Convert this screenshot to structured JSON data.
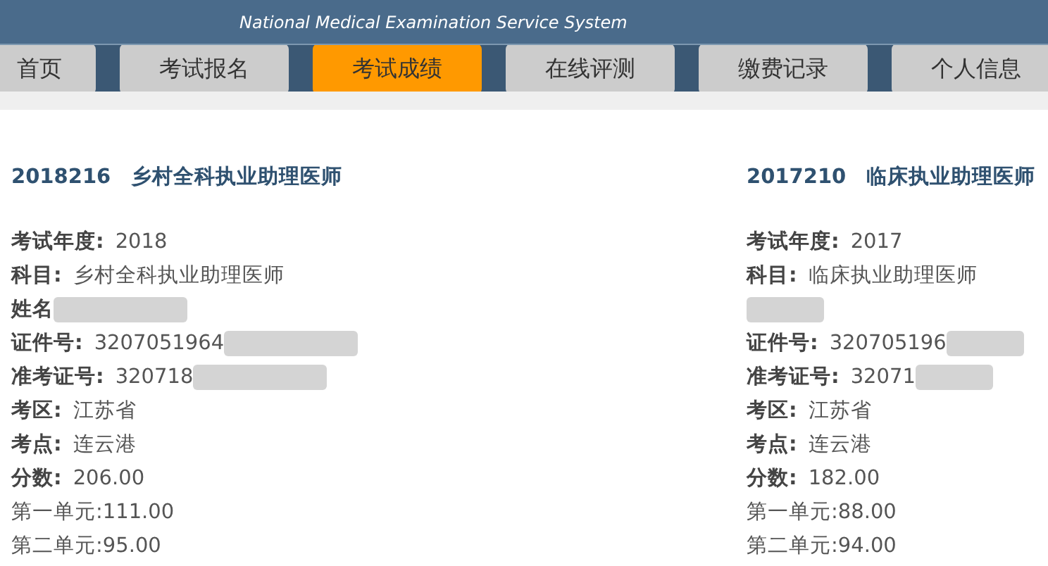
{
  "header": {
    "subtitle": "National Medical Examination Service System"
  },
  "tabs": [
    {
      "label": "首页",
      "selected": false
    },
    {
      "label": "考试报名",
      "selected": false
    },
    {
      "label": "考试成绩",
      "selected": true
    },
    {
      "label": "在线评测",
      "selected": false
    },
    {
      "label": "缴费记录",
      "selected": false
    },
    {
      "label": "个人信息",
      "selected": false
    }
  ],
  "results": [
    {
      "code": "2018216",
      "title": "乡村全科执业助理医师",
      "fields": [
        {
          "kind": "field",
          "label": "考试年度:",
          "value": "2018"
        },
        {
          "kind": "field",
          "label": "科目:",
          "value": "乡村全科执业助理医师"
        },
        {
          "kind": "redacted",
          "label": "姓名"
        },
        {
          "kind": "redacted",
          "label": "证件号:",
          "value": "3207051964"
        },
        {
          "kind": "redacted",
          "label": "准考证号:",
          "value": "320718"
        },
        {
          "kind": "field",
          "label": "考区:",
          "value": "江苏省"
        },
        {
          "kind": "field",
          "label": "考点:",
          "value": "连云港"
        },
        {
          "kind": "field",
          "label": "分数:",
          "value": "206.00"
        },
        {
          "kind": "unit",
          "value": "第一单元:111.00"
        },
        {
          "kind": "unit",
          "value": "第二单元:95.00"
        }
      ]
    },
    {
      "code": "2017210",
      "title": "临床执业助理医师",
      "fields": [
        {
          "kind": "field",
          "label": "考试年度:",
          "value": "2017"
        },
        {
          "kind": "field",
          "label": "科目:",
          "value": "临床执业助理医师"
        },
        {
          "kind": "redacted"
        },
        {
          "kind": "redacted",
          "label": "证件号:",
          "value": "320705196"
        },
        {
          "kind": "redacted",
          "label": "准考证号:",
          "value": "32071"
        },
        {
          "kind": "field",
          "label": "考区:",
          "value": "江苏省"
        },
        {
          "kind": "field",
          "label": "考点:",
          "value": "连云港"
        },
        {
          "kind": "field",
          "label": "分数:",
          "value": "182.00"
        },
        {
          "kind": "unit",
          "value": "第一单元:88.00"
        },
        {
          "kind": "unit",
          "value": "第二单元:94.00"
        }
      ]
    }
  ]
}
